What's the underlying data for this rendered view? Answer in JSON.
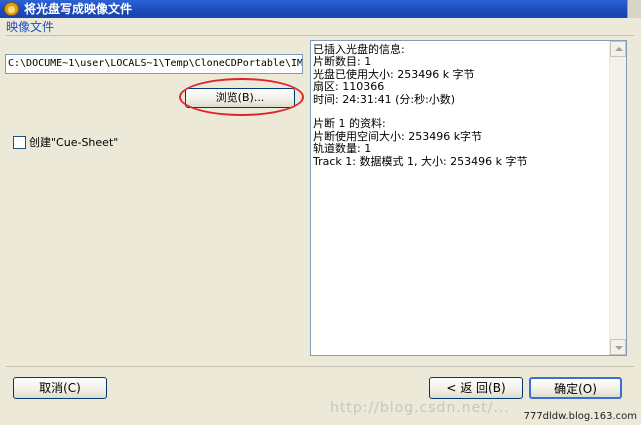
{
  "window": {
    "title": "将光盘写成映像文件"
  },
  "section": {
    "label": "映像文件"
  },
  "path_field": {
    "value": "C:\\DOCUME~1\\user\\LOCALS~1\\Temp\\CloneCDPortable\\IM"
  },
  "buttons": {
    "browse": "浏览(B)...",
    "cancel": "取消(C)",
    "back": "< 返 回(B)",
    "ok": "确定(O)"
  },
  "checkbox": {
    "label": "创建\"Cue-Sheet\"",
    "checked": false
  },
  "info_lines": [
    "已插入光盘的信息:",
    "片断数目: 1",
    "光盘已使用大小: 253496 k 字节",
    "扇区: 110366",
    "时间: 24:31:41 (分:秒:小数)",
    "",
    "片断 1 的资料:",
    "片断使用空间大小: 253496 k字节",
    "轨道数量: 1",
    "Track 1: 数据模式 1, 大小: 253496 k 字节"
  ],
  "watermark": "http://blog.csdn.net/...",
  "credit": "777dldw.blog.163.com",
  "colors": {
    "title_bar": "#1c48b8",
    "highlight": "#e0242a",
    "section_label": "#1f4cc4"
  }
}
